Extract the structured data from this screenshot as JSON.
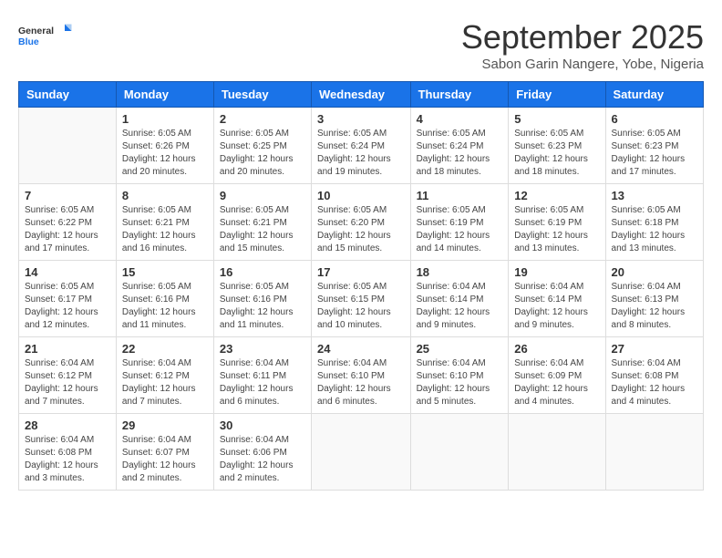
{
  "logo": {
    "line1": "General",
    "line2": "Blue"
  },
  "title": "September 2025",
  "subtitle": "Sabon Garin Nangere, Yobe, Nigeria",
  "days_of_week": [
    "Sunday",
    "Monday",
    "Tuesday",
    "Wednesday",
    "Thursday",
    "Friday",
    "Saturday"
  ],
  "weeks": [
    [
      {
        "day": "",
        "sunrise": "",
        "sunset": "",
        "daylight": ""
      },
      {
        "day": "1",
        "sunrise": "6:05 AM",
        "sunset": "6:26 PM",
        "daylight": "12 hours and 20 minutes."
      },
      {
        "day": "2",
        "sunrise": "6:05 AM",
        "sunset": "6:25 PM",
        "daylight": "12 hours and 20 minutes."
      },
      {
        "day": "3",
        "sunrise": "6:05 AM",
        "sunset": "6:24 PM",
        "daylight": "12 hours and 19 minutes."
      },
      {
        "day": "4",
        "sunrise": "6:05 AM",
        "sunset": "6:24 PM",
        "daylight": "12 hours and 18 minutes."
      },
      {
        "day": "5",
        "sunrise": "6:05 AM",
        "sunset": "6:23 PM",
        "daylight": "12 hours and 18 minutes."
      },
      {
        "day": "6",
        "sunrise": "6:05 AM",
        "sunset": "6:23 PM",
        "daylight": "12 hours and 17 minutes."
      }
    ],
    [
      {
        "day": "7",
        "sunrise": "6:05 AM",
        "sunset": "6:22 PM",
        "daylight": "12 hours and 17 minutes."
      },
      {
        "day": "8",
        "sunrise": "6:05 AM",
        "sunset": "6:21 PM",
        "daylight": "12 hours and 16 minutes."
      },
      {
        "day": "9",
        "sunrise": "6:05 AM",
        "sunset": "6:21 PM",
        "daylight": "12 hours and 15 minutes."
      },
      {
        "day": "10",
        "sunrise": "6:05 AM",
        "sunset": "6:20 PM",
        "daylight": "12 hours and 15 minutes."
      },
      {
        "day": "11",
        "sunrise": "6:05 AM",
        "sunset": "6:19 PM",
        "daylight": "12 hours and 14 minutes."
      },
      {
        "day": "12",
        "sunrise": "6:05 AM",
        "sunset": "6:19 PM",
        "daylight": "12 hours and 13 minutes."
      },
      {
        "day": "13",
        "sunrise": "6:05 AM",
        "sunset": "6:18 PM",
        "daylight": "12 hours and 13 minutes."
      }
    ],
    [
      {
        "day": "14",
        "sunrise": "6:05 AM",
        "sunset": "6:17 PM",
        "daylight": "12 hours and 12 minutes."
      },
      {
        "day": "15",
        "sunrise": "6:05 AM",
        "sunset": "6:16 PM",
        "daylight": "12 hours and 11 minutes."
      },
      {
        "day": "16",
        "sunrise": "6:05 AM",
        "sunset": "6:16 PM",
        "daylight": "12 hours and 11 minutes."
      },
      {
        "day": "17",
        "sunrise": "6:05 AM",
        "sunset": "6:15 PM",
        "daylight": "12 hours and 10 minutes."
      },
      {
        "day": "18",
        "sunrise": "6:04 AM",
        "sunset": "6:14 PM",
        "daylight": "12 hours and 9 minutes."
      },
      {
        "day": "19",
        "sunrise": "6:04 AM",
        "sunset": "6:14 PM",
        "daylight": "12 hours and 9 minutes."
      },
      {
        "day": "20",
        "sunrise": "6:04 AM",
        "sunset": "6:13 PM",
        "daylight": "12 hours and 8 minutes."
      }
    ],
    [
      {
        "day": "21",
        "sunrise": "6:04 AM",
        "sunset": "6:12 PM",
        "daylight": "12 hours and 7 minutes."
      },
      {
        "day": "22",
        "sunrise": "6:04 AM",
        "sunset": "6:12 PM",
        "daylight": "12 hours and 7 minutes."
      },
      {
        "day": "23",
        "sunrise": "6:04 AM",
        "sunset": "6:11 PM",
        "daylight": "12 hours and 6 minutes."
      },
      {
        "day": "24",
        "sunrise": "6:04 AM",
        "sunset": "6:10 PM",
        "daylight": "12 hours and 6 minutes."
      },
      {
        "day": "25",
        "sunrise": "6:04 AM",
        "sunset": "6:10 PM",
        "daylight": "12 hours and 5 minutes."
      },
      {
        "day": "26",
        "sunrise": "6:04 AM",
        "sunset": "6:09 PM",
        "daylight": "12 hours and 4 minutes."
      },
      {
        "day": "27",
        "sunrise": "6:04 AM",
        "sunset": "6:08 PM",
        "daylight": "12 hours and 4 minutes."
      }
    ],
    [
      {
        "day": "28",
        "sunrise": "6:04 AM",
        "sunset": "6:08 PM",
        "daylight": "12 hours and 3 minutes."
      },
      {
        "day": "29",
        "sunrise": "6:04 AM",
        "sunset": "6:07 PM",
        "daylight": "12 hours and 2 minutes."
      },
      {
        "day": "30",
        "sunrise": "6:04 AM",
        "sunset": "6:06 PM",
        "daylight": "12 hours and 2 minutes."
      },
      {
        "day": "",
        "sunrise": "",
        "sunset": "",
        "daylight": ""
      },
      {
        "day": "",
        "sunrise": "",
        "sunset": "",
        "daylight": ""
      },
      {
        "day": "",
        "sunrise": "",
        "sunset": "",
        "daylight": ""
      },
      {
        "day": "",
        "sunrise": "",
        "sunset": "",
        "daylight": ""
      }
    ]
  ]
}
